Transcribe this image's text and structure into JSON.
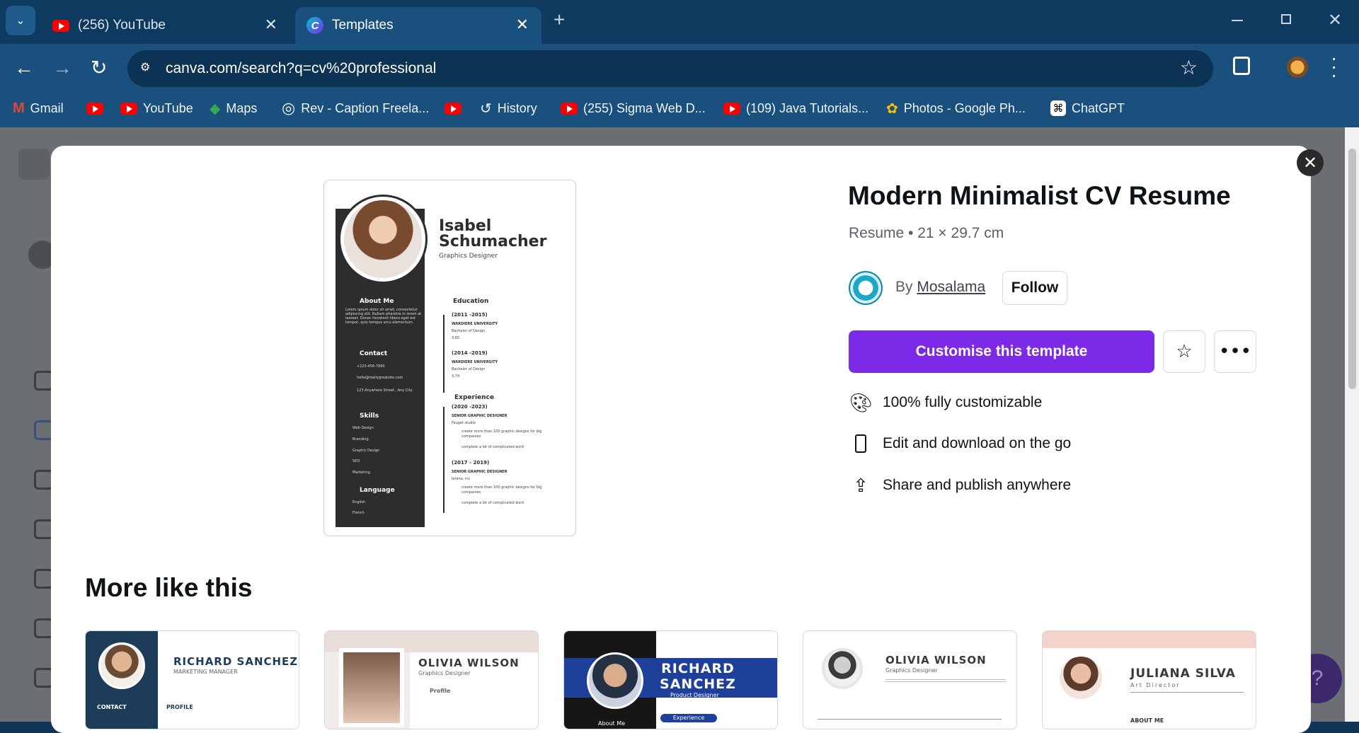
{
  "browser": {
    "tabs": [
      {
        "title": "(256) YouTube",
        "icon": "youtube-icon",
        "active": false
      },
      {
        "title": "Templates",
        "icon": "canva-icon",
        "active": true
      }
    ],
    "new_tab": "+",
    "url": "canva.com/search?q=cv%20professional",
    "bookmarks": [
      {
        "label": "Gmail",
        "icon": "gmail-icon"
      },
      {
        "label": "",
        "icon": "youtube-icon"
      },
      {
        "label": "YouTube",
        "icon": "youtube-icon"
      },
      {
        "label": "Maps",
        "icon": "maps-icon"
      },
      {
        "label": "Rev - Caption Freela...",
        "icon": "rev-icon"
      },
      {
        "label": "",
        "icon": "youtube-icon"
      },
      {
        "label": "History",
        "icon": "history-icon"
      },
      {
        "label": "(255) Sigma Web D...",
        "icon": "youtube-icon"
      },
      {
        "label": "(109) Java Tutorials...",
        "icon": "youtube-icon"
      },
      {
        "label": "Photos - Google Ph...",
        "icon": "photos-icon"
      },
      {
        "label": "ChatGPT",
        "icon": "chatgpt-icon"
      }
    ]
  },
  "template": {
    "title": "Modern Minimalist CV Resume",
    "meta": "Resume • 21 × 29.7 cm",
    "by": "By",
    "author": "Mosalama",
    "follow": "Follow",
    "cta": "Customise this template",
    "features": [
      {
        "icon": "palette-icon",
        "text": "100% fully customizable"
      },
      {
        "icon": "phone-icon",
        "text": "Edit and download on the go"
      },
      {
        "icon": "share-icon",
        "text": "Share and publish anywhere"
      }
    ]
  },
  "resume": {
    "first": "Isabel",
    "last": "Schumacher",
    "role": "Graphics Designer",
    "about_h": "About Me",
    "about_t": "Lorem ipsum dolor sit amet, consectetur adipiscing elit. Nullam pharetra in lorem at laoreet. Donec hendrerit libero eget est tempor, quis tempus arcu elementum.",
    "contact_h": "Contact",
    "contact": [
      "+123-456-7890",
      "hello@reallygreatsite.com",
      "123 Anywhere Street., Any City"
    ],
    "skills_h": "Skills",
    "skills": [
      "Web Design",
      "Branding",
      "Graphic Design",
      "SEO",
      "Marketing"
    ],
    "lang_h": "Language",
    "langs": [
      "English",
      "French"
    ],
    "edu_h": "Education",
    "edu": [
      {
        "years": "(2011 -2015)",
        "school": "WARDIERE UNIVERSITY",
        "deg": "Bachelor of Design",
        "gpa": "3.65"
      },
      {
        "years": "(2014 -2019)",
        "school": "WARDIERE UNIVERSITY",
        "deg": "Bachelor of Design",
        "gpa": "3.74"
      }
    ],
    "exp_h": "Experience",
    "exp": [
      {
        "years": "(2020 -2023)",
        "role": "SENIOR GRAPHIC DESIGNER",
        "co": "Fauget studio",
        "b1": "create more than 100 graphic designs for big companies",
        "b2": "complete a lot of complicated work"
      },
      {
        "years": "(2017 - 2019)",
        "role": "SENIOR GRAPHIC DESIGNER",
        "co": "larana, inc",
        "b1": "create more than 100 graphic designs for big companies",
        "b2": "complete a lot of complicated work"
      }
    ]
  },
  "more": {
    "heading": "More like this",
    "items": [
      {
        "name": "RICHARD SANCHEZ",
        "sub": "MARKETING MANAGER",
        "s1": "CONTACT",
        "s2": "PROFILE"
      },
      {
        "name": "OLIVIA WILSON",
        "sub": "Graphics Designer",
        "s1": "Profile"
      },
      {
        "name": "RICHARD SANCHEZ",
        "sub": "Product Designer",
        "s1": "About Me",
        "s2": "Experience"
      },
      {
        "name": "OLIVIA WILSON",
        "sub": "Graphics Designer"
      },
      {
        "name": "JULIANA SILVA",
        "sub": "Art Director",
        "s1": "ABOUT ME"
      }
    ]
  },
  "colors": {
    "accent": "#7d2ae8",
    "toolbar": "#19507e",
    "tabbar": "#0d3a5e"
  }
}
